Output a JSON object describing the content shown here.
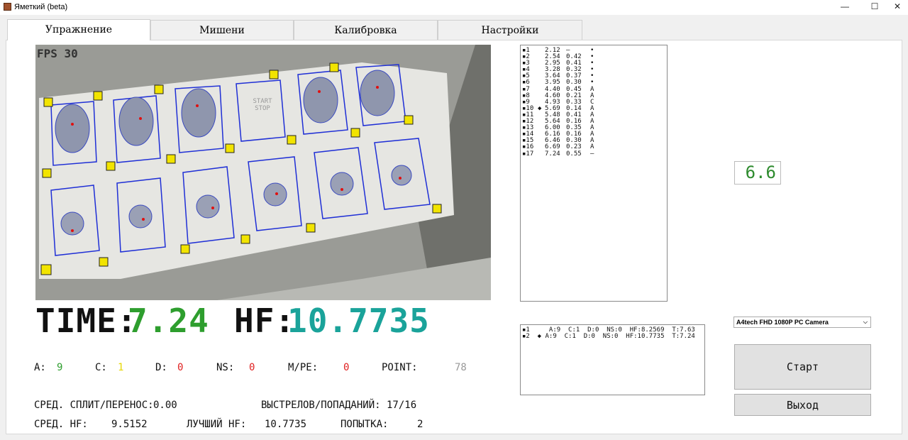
{
  "window": {
    "title": "Яметкий (beta)",
    "minimize": "—",
    "maximize": "☐",
    "close": "✕"
  },
  "tabs": [
    {
      "label": "Упражнение"
    },
    {
      "label": "Мишени"
    },
    {
      "label": "Калибровка"
    },
    {
      "label": "Настройки"
    }
  ],
  "camera": {
    "fps": "FPS 30",
    "start_stop_label": "START STOP"
  },
  "time": {
    "label": "TIME:",
    "value": "7.24"
  },
  "hf": {
    "label": "HF:",
    "value": "10.7735"
  },
  "stats": {
    "a": {
      "label": "A:",
      "value": "9",
      "color": "#2e9e2e"
    },
    "c": {
      "label": "C:",
      "value": "1",
      "color": "#e6d600"
    },
    "d": {
      "label": "D:",
      "value": "0",
      "color": "#e02020"
    },
    "ns": {
      "label": "NS:",
      "value": "0",
      "color": "#e02020"
    },
    "mpe": {
      "label": "M/PE:",
      "value": "0",
      "color": "#e02020"
    },
    "point": {
      "label": "POINT:",
      "value": "78",
      "color": "#999999"
    }
  },
  "summary": {
    "avg_split_label": "СРЕД. СПЛИТ/ПЕРЕНОС:",
    "avg_split": "0.00",
    "shots_hits_label": "ВЫСТРЕЛОВ/ПОПАДАНИЙ:",
    "shots_hits": "17/16",
    "avg_hf_label": "СРЕД. HF:",
    "avg_hf": "9.5152",
    "best_hf_label": "ЛУЧШИЙ HF:",
    "best_hf": "10.7735",
    "attempt_label": "ПОПЫТКА:",
    "attempt": "2"
  },
  "shots": [
    {
      "n": "▪1",
      "mark": "",
      "t": "2.12",
      "split": "–",
      "zone": "•"
    },
    {
      "n": "▪2",
      "mark": "",
      "t": "2.54",
      "split": "0.42",
      "zone": "•"
    },
    {
      "n": "▪3",
      "mark": "",
      "t": "2.95",
      "split": "0.41",
      "zone": "•"
    },
    {
      "n": "▪4",
      "mark": "",
      "t": "3.28",
      "split": "0.32",
      "zone": "•"
    },
    {
      "n": "▪5",
      "mark": "",
      "t": "3.64",
      "split": "0.37",
      "zone": "•"
    },
    {
      "n": "▪6",
      "mark": "",
      "t": "3.95",
      "split": "0.30",
      "zone": "•"
    },
    {
      "n": "▪7",
      "mark": "",
      "t": "4.40",
      "split": "0.45",
      "zone": "A"
    },
    {
      "n": "▪8",
      "mark": "",
      "t": "4.60",
      "split": "0.21",
      "zone": "A"
    },
    {
      "n": "▪9",
      "mark": "",
      "t": "4.93",
      "split": "0.33",
      "zone": "C"
    },
    {
      "n": "▪10",
      "mark": "◆",
      "t": "5.69",
      "split": "0.14",
      "zone": "A"
    },
    {
      "n": "▪11",
      "mark": "",
      "t": "5.48",
      "split": "0.41",
      "zone": "A"
    },
    {
      "n": "▪12",
      "mark": "",
      "t": "5.64",
      "split": "0.16",
      "zone": "A"
    },
    {
      "n": "▪13",
      "mark": "",
      "t": "6.00",
      "split": "0.35",
      "zone": "A"
    },
    {
      "n": "▪14",
      "mark": "",
      "t": "6.16",
      "split": "0.16",
      "zone": "A"
    },
    {
      "n": "▪15",
      "mark": "",
      "t": "6.46",
      "split": "0.30",
      "zone": "A"
    },
    {
      "n": "▪16",
      "mark": "",
      "t": "6.69",
      "split": "0.23",
      "zone": "A"
    },
    {
      "n": "▪17",
      "mark": "",
      "t": "7.24",
      "split": "0.55",
      "zone": "–"
    }
  ],
  "current_display": "6.6",
  "attempts": [
    {
      "text": "▪1     A:9  C:1  D:0  NS:0  HF:8.2569  T:7.63"
    },
    {
      "text": "▪2  ◆ A:9  C:1  D:0  NS:0  HF:10.7735  T:7.24"
    }
  ],
  "camera_select": {
    "value": "A4tech FHD 1080P PC Camera",
    "arrow": "⌵"
  },
  "buttons": {
    "start": "Старт",
    "exit": "Выход"
  }
}
